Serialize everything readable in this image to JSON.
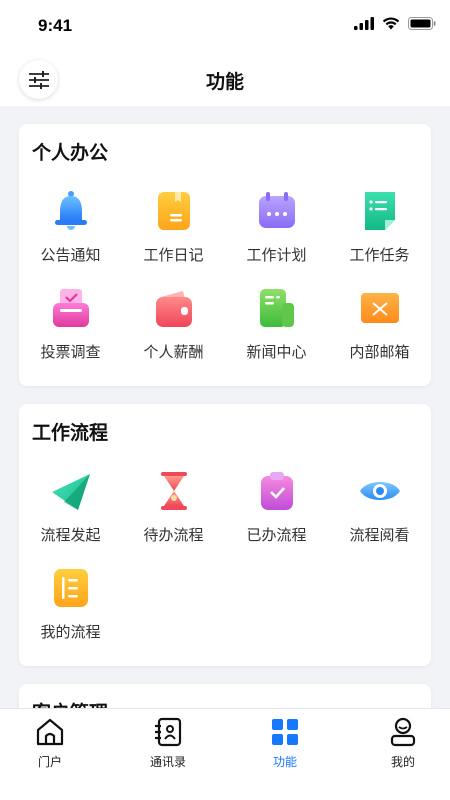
{
  "status": {
    "time": "9:41"
  },
  "nav": {
    "title": "功能"
  },
  "sections": [
    {
      "title": "个人办公",
      "items": [
        {
          "label": "公告通知",
          "icon": "bell-icon"
        },
        {
          "label": "工作日记",
          "icon": "diary-icon"
        },
        {
          "label": "工作计划",
          "icon": "calendar-icon"
        },
        {
          "label": "工作任务",
          "icon": "task-icon"
        },
        {
          "label": "投票调查",
          "icon": "ballot-box-icon"
        },
        {
          "label": "个人薪酬",
          "icon": "wallet-icon"
        },
        {
          "label": "新闻中心",
          "icon": "news-icon"
        },
        {
          "label": "内部邮箱",
          "icon": "mail-icon"
        }
      ]
    },
    {
      "title": "工作流程",
      "items": [
        {
          "label": "流程发起",
          "icon": "send-icon"
        },
        {
          "label": "待办流程",
          "icon": "hourglass-icon"
        },
        {
          "label": "已办流程",
          "icon": "clipboard-check-icon"
        },
        {
          "label": "流程阅看",
          "icon": "eye-icon"
        },
        {
          "label": "我的流程",
          "icon": "list-icon"
        }
      ]
    },
    {
      "title": "客户管理",
      "items": []
    }
  ],
  "tabbar": {
    "items": [
      {
        "label": "门户",
        "icon": "home-icon",
        "active": false
      },
      {
        "label": "通讯录",
        "icon": "contacts-icon",
        "active": false
      },
      {
        "label": "功能",
        "icon": "grid-icon",
        "active": true
      },
      {
        "label": "我的",
        "icon": "profile-icon",
        "active": false
      }
    ]
  },
  "colors": {
    "accent": "#1677ff",
    "background": "#f2f3f7",
    "card": "#ffffff"
  }
}
